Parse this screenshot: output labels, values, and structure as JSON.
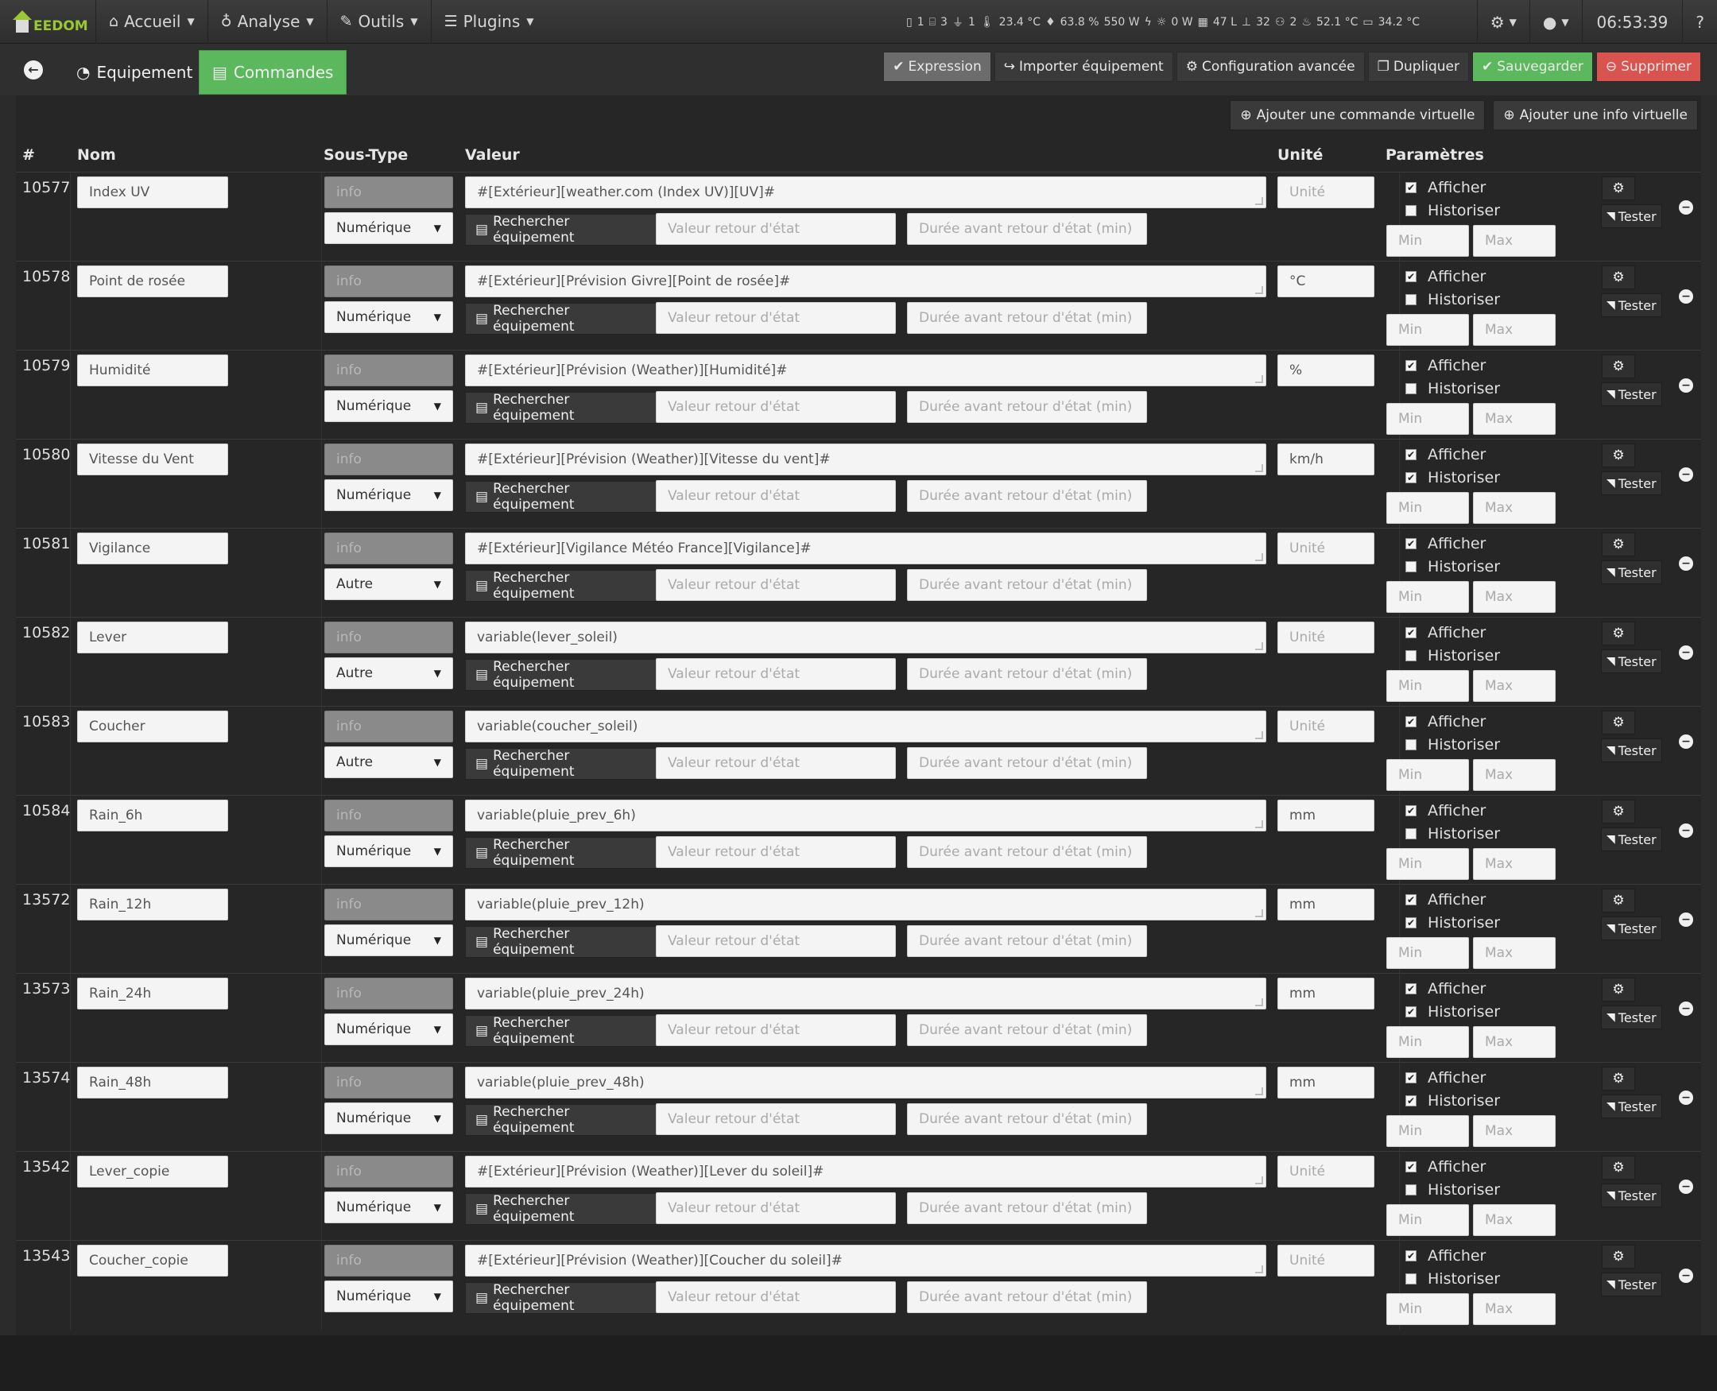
{
  "navbar": {
    "brand": "EEDOM",
    "menu": [
      {
        "label": "Accueil",
        "icon": "home-icon"
      },
      {
        "label": "Analyse",
        "icon": "stethoscope-icon"
      },
      {
        "label": "Outils",
        "icon": "wrench-icon"
      },
      {
        "label": "Plugins",
        "icon": "list-icon"
      }
    ],
    "status": [
      "1",
      "3",
      "1",
      "23.4 °C",
      "63.8 %",
      "550 W",
      "0 W",
      "47 L",
      "32",
      "2",
      "52.1 °C",
      "34.2 °C"
    ],
    "clock": "06:53:39",
    "help": "?"
  },
  "tabs": {
    "equipement": "Equipement",
    "commandes": "Commandes"
  },
  "actions": {
    "expression": "Expression",
    "importer": "Importer équipement",
    "config": "Configuration avancée",
    "dupliquer": "Dupliquer",
    "sauvegarder": "Sauvegarder",
    "supprimer": "Supprimer"
  },
  "panel": {
    "add_cmd": "Ajouter une commande virtuelle",
    "add_info": "Ajouter une info virtuelle"
  },
  "table": {
    "headers": {
      "id": "#",
      "nom": "Nom",
      "soustype": "Sous-Type",
      "valeur": "Valeur",
      "unite": "Unité",
      "params": "Paramètres"
    },
    "labels": {
      "search": "Rechercher équipement",
      "retour_ph": "Valeur retour d'état",
      "duree_ph": "Durée avant retour d'état (min)",
      "unit_ph": "Unité",
      "afficher": "Afficher",
      "historiser": "Historiser",
      "min_ph": "Min",
      "max_ph": "Max",
      "tester": "Tester",
      "type": "info"
    },
    "rows": [
      {
        "id": "10577",
        "name": "Index UV",
        "subtype": "Numérique",
        "value": "#[Extérieur][weather.com (Index UV)][UV]#",
        "unit": "",
        "afficher": true,
        "historiser": false
      },
      {
        "id": "10578",
        "name": "Point de rosée",
        "subtype": "Numérique",
        "value": "#[Extérieur][Prévision Givre][Point de rosée]#",
        "unit": "°C",
        "afficher": true,
        "historiser": false
      },
      {
        "id": "10579",
        "name": "Humidité",
        "subtype": "Numérique",
        "value": "#[Extérieur][Prévision (Weather)][Humidité]#",
        "unit": "%",
        "afficher": true,
        "historiser": false
      },
      {
        "id": "10580",
        "name": "Vitesse du Vent",
        "subtype": "Numérique",
        "value": "#[Extérieur][Prévision (Weather)][Vitesse du vent]#",
        "unit": "km/h",
        "afficher": true,
        "historiser": true
      },
      {
        "id": "10581",
        "name": "Vigilance",
        "subtype": "Autre",
        "value": "#[Extérieur][Vigilance Météo France][Vigilance]#",
        "unit": "",
        "afficher": true,
        "historiser": false
      },
      {
        "id": "10582",
        "name": "Lever",
        "subtype": "Autre",
        "value": "variable(lever_soleil)",
        "unit": "",
        "afficher": true,
        "historiser": false
      },
      {
        "id": "10583",
        "name": "Coucher",
        "subtype": "Autre",
        "value": "variable(coucher_soleil)",
        "unit": "",
        "afficher": true,
        "historiser": false
      },
      {
        "id": "10584",
        "name": "Rain_6h",
        "subtype": "Numérique",
        "value": "variable(pluie_prev_6h)",
        "unit": "mm",
        "afficher": true,
        "historiser": false
      },
      {
        "id": "13572",
        "name": "Rain_12h",
        "subtype": "Numérique",
        "value": "variable(pluie_prev_12h)",
        "unit": "mm",
        "afficher": true,
        "historiser": true
      },
      {
        "id": "13573",
        "name": "Rain_24h",
        "subtype": "Numérique",
        "value": "variable(pluie_prev_24h)",
        "unit": "mm",
        "afficher": true,
        "historiser": true
      },
      {
        "id": "13574",
        "name": "Rain_48h",
        "subtype": "Numérique",
        "value": "variable(pluie_prev_48h)",
        "unit": "mm",
        "afficher": true,
        "historiser": true
      },
      {
        "id": "13542",
        "name": "Lever_copie",
        "subtype": "Numérique",
        "value": "#[Extérieur][Prévision (Weather)][Lever du soleil]#",
        "unit": "",
        "afficher": true,
        "historiser": false
      },
      {
        "id": "13543",
        "name": "Coucher_copie",
        "subtype": "Numérique",
        "value": "#[Extérieur][Prévision (Weather)][Coucher du soleil]#",
        "unit": "",
        "afficher": true,
        "historiser": false
      }
    ]
  }
}
